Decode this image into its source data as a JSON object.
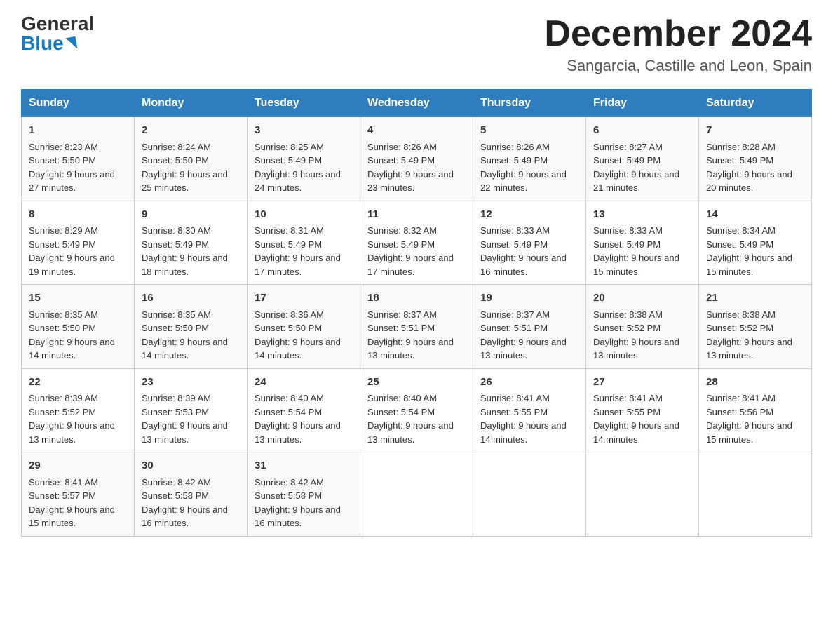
{
  "header": {
    "logo_general": "General",
    "logo_blue": "Blue",
    "month_year": "December 2024",
    "location": "Sangarcia, Castille and Leon, Spain"
  },
  "days_of_week": [
    "Sunday",
    "Monday",
    "Tuesday",
    "Wednesday",
    "Thursday",
    "Friday",
    "Saturday"
  ],
  "weeks": [
    [
      {
        "day": "1",
        "sunrise": "Sunrise: 8:23 AM",
        "sunset": "Sunset: 5:50 PM",
        "daylight": "Daylight: 9 hours and 27 minutes."
      },
      {
        "day": "2",
        "sunrise": "Sunrise: 8:24 AM",
        "sunset": "Sunset: 5:50 PM",
        "daylight": "Daylight: 9 hours and 25 minutes."
      },
      {
        "day": "3",
        "sunrise": "Sunrise: 8:25 AM",
        "sunset": "Sunset: 5:49 PM",
        "daylight": "Daylight: 9 hours and 24 minutes."
      },
      {
        "day": "4",
        "sunrise": "Sunrise: 8:26 AM",
        "sunset": "Sunset: 5:49 PM",
        "daylight": "Daylight: 9 hours and 23 minutes."
      },
      {
        "day": "5",
        "sunrise": "Sunrise: 8:26 AM",
        "sunset": "Sunset: 5:49 PM",
        "daylight": "Daylight: 9 hours and 22 minutes."
      },
      {
        "day": "6",
        "sunrise": "Sunrise: 8:27 AM",
        "sunset": "Sunset: 5:49 PM",
        "daylight": "Daylight: 9 hours and 21 minutes."
      },
      {
        "day": "7",
        "sunrise": "Sunrise: 8:28 AM",
        "sunset": "Sunset: 5:49 PM",
        "daylight": "Daylight: 9 hours and 20 minutes."
      }
    ],
    [
      {
        "day": "8",
        "sunrise": "Sunrise: 8:29 AM",
        "sunset": "Sunset: 5:49 PM",
        "daylight": "Daylight: 9 hours and 19 minutes."
      },
      {
        "day": "9",
        "sunrise": "Sunrise: 8:30 AM",
        "sunset": "Sunset: 5:49 PM",
        "daylight": "Daylight: 9 hours and 18 minutes."
      },
      {
        "day": "10",
        "sunrise": "Sunrise: 8:31 AM",
        "sunset": "Sunset: 5:49 PM",
        "daylight": "Daylight: 9 hours and 17 minutes."
      },
      {
        "day": "11",
        "sunrise": "Sunrise: 8:32 AM",
        "sunset": "Sunset: 5:49 PM",
        "daylight": "Daylight: 9 hours and 17 minutes."
      },
      {
        "day": "12",
        "sunrise": "Sunrise: 8:33 AM",
        "sunset": "Sunset: 5:49 PM",
        "daylight": "Daylight: 9 hours and 16 minutes."
      },
      {
        "day": "13",
        "sunrise": "Sunrise: 8:33 AM",
        "sunset": "Sunset: 5:49 PM",
        "daylight": "Daylight: 9 hours and 15 minutes."
      },
      {
        "day": "14",
        "sunrise": "Sunrise: 8:34 AM",
        "sunset": "Sunset: 5:49 PM",
        "daylight": "Daylight: 9 hours and 15 minutes."
      }
    ],
    [
      {
        "day": "15",
        "sunrise": "Sunrise: 8:35 AM",
        "sunset": "Sunset: 5:50 PM",
        "daylight": "Daylight: 9 hours and 14 minutes."
      },
      {
        "day": "16",
        "sunrise": "Sunrise: 8:35 AM",
        "sunset": "Sunset: 5:50 PM",
        "daylight": "Daylight: 9 hours and 14 minutes."
      },
      {
        "day": "17",
        "sunrise": "Sunrise: 8:36 AM",
        "sunset": "Sunset: 5:50 PM",
        "daylight": "Daylight: 9 hours and 14 minutes."
      },
      {
        "day": "18",
        "sunrise": "Sunrise: 8:37 AM",
        "sunset": "Sunset: 5:51 PM",
        "daylight": "Daylight: 9 hours and 13 minutes."
      },
      {
        "day": "19",
        "sunrise": "Sunrise: 8:37 AM",
        "sunset": "Sunset: 5:51 PM",
        "daylight": "Daylight: 9 hours and 13 minutes."
      },
      {
        "day": "20",
        "sunrise": "Sunrise: 8:38 AM",
        "sunset": "Sunset: 5:52 PM",
        "daylight": "Daylight: 9 hours and 13 minutes."
      },
      {
        "day": "21",
        "sunrise": "Sunrise: 8:38 AM",
        "sunset": "Sunset: 5:52 PM",
        "daylight": "Daylight: 9 hours and 13 minutes."
      }
    ],
    [
      {
        "day": "22",
        "sunrise": "Sunrise: 8:39 AM",
        "sunset": "Sunset: 5:52 PM",
        "daylight": "Daylight: 9 hours and 13 minutes."
      },
      {
        "day": "23",
        "sunrise": "Sunrise: 8:39 AM",
        "sunset": "Sunset: 5:53 PM",
        "daylight": "Daylight: 9 hours and 13 minutes."
      },
      {
        "day": "24",
        "sunrise": "Sunrise: 8:40 AM",
        "sunset": "Sunset: 5:54 PM",
        "daylight": "Daylight: 9 hours and 13 minutes."
      },
      {
        "day": "25",
        "sunrise": "Sunrise: 8:40 AM",
        "sunset": "Sunset: 5:54 PM",
        "daylight": "Daylight: 9 hours and 13 minutes."
      },
      {
        "day": "26",
        "sunrise": "Sunrise: 8:41 AM",
        "sunset": "Sunset: 5:55 PM",
        "daylight": "Daylight: 9 hours and 14 minutes."
      },
      {
        "day": "27",
        "sunrise": "Sunrise: 8:41 AM",
        "sunset": "Sunset: 5:55 PM",
        "daylight": "Daylight: 9 hours and 14 minutes."
      },
      {
        "day": "28",
        "sunrise": "Sunrise: 8:41 AM",
        "sunset": "Sunset: 5:56 PM",
        "daylight": "Daylight: 9 hours and 15 minutes."
      }
    ],
    [
      {
        "day": "29",
        "sunrise": "Sunrise: 8:41 AM",
        "sunset": "Sunset: 5:57 PM",
        "daylight": "Daylight: 9 hours and 15 minutes."
      },
      {
        "day": "30",
        "sunrise": "Sunrise: 8:42 AM",
        "sunset": "Sunset: 5:58 PM",
        "daylight": "Daylight: 9 hours and 16 minutes."
      },
      {
        "day": "31",
        "sunrise": "Sunrise: 8:42 AM",
        "sunset": "Sunset: 5:58 PM",
        "daylight": "Daylight: 9 hours and 16 minutes."
      },
      null,
      null,
      null,
      null
    ]
  ]
}
